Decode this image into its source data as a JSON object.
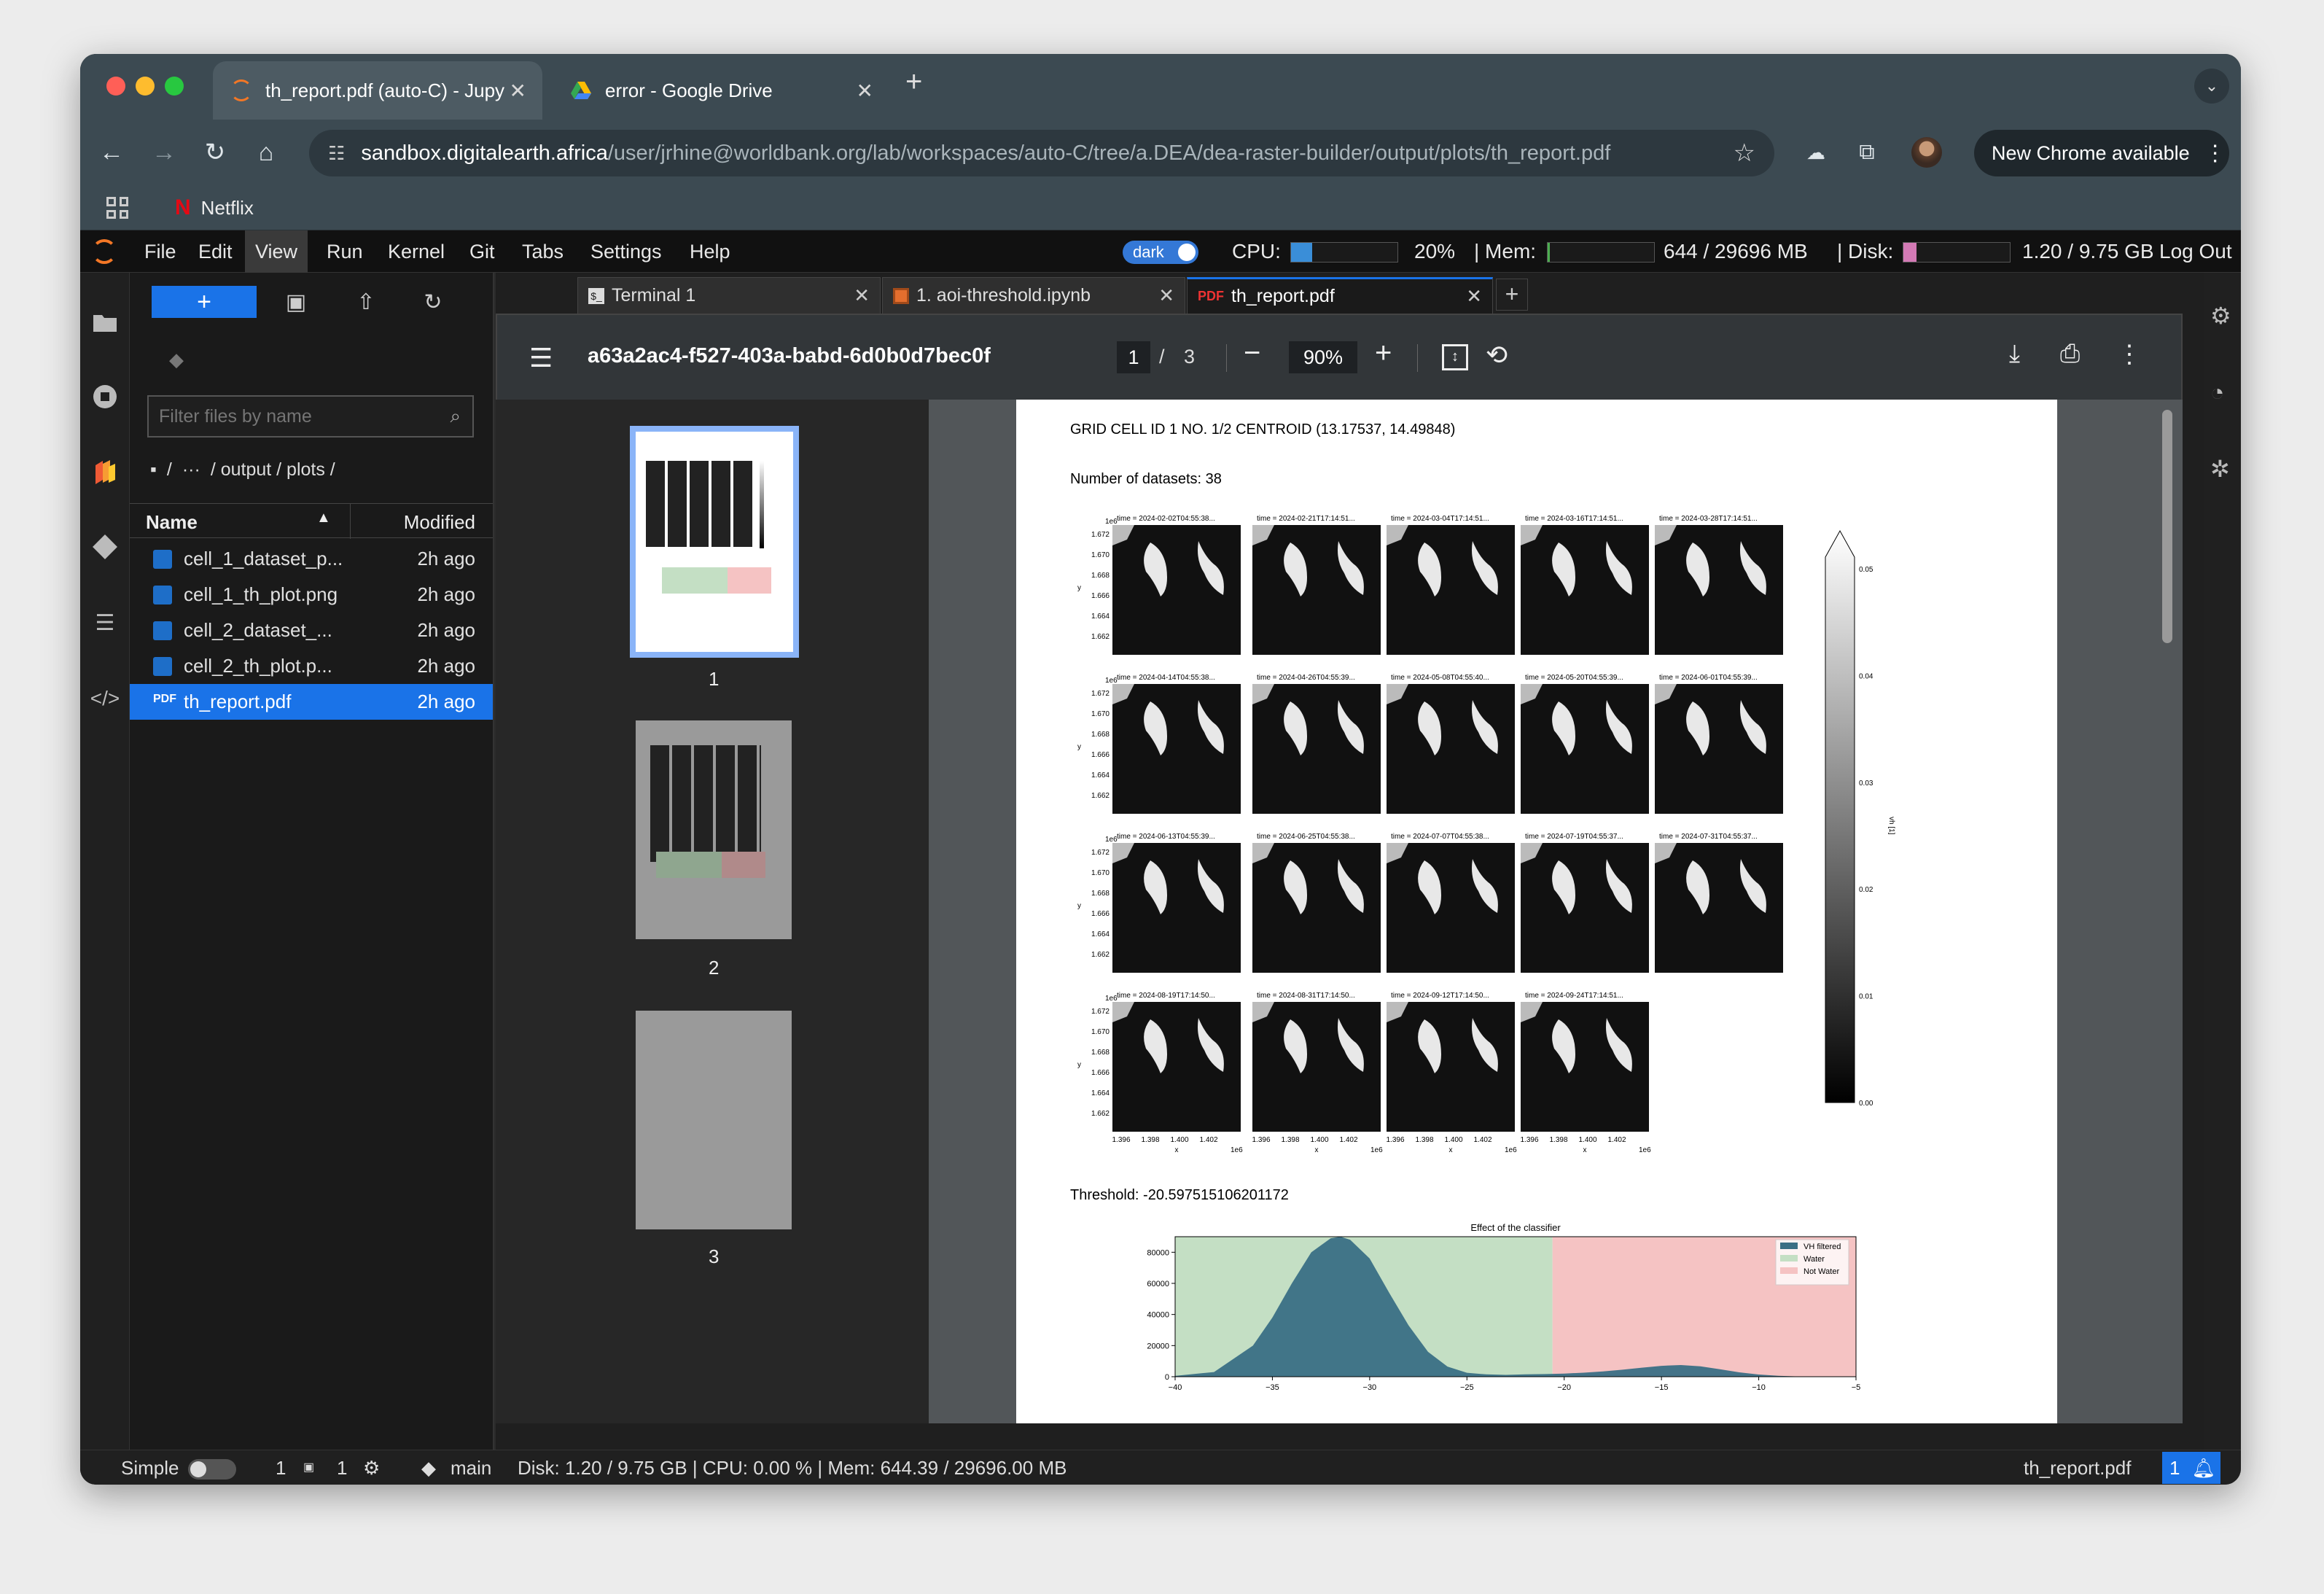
{
  "browser": {
    "tabs": [
      {
        "title": "th_report.pdf (auto-C) - Jupy"
      },
      {
        "title": "error - Google Drive"
      }
    ],
    "new_tab": "+",
    "url_host": "sandbox.digitalearth.africa",
    "url_path": "/user/jrhine@worldbank.org/lab/workspaces/auto-C/tree/a.DEA/dea-raster-builder/output/plots/th_report.pdf",
    "update_label": "New Chrome available",
    "bookmarks": [
      {
        "label": "Netflix"
      }
    ]
  },
  "menu": [
    "File",
    "Edit",
    "View",
    "Run",
    "Kernel",
    "Git",
    "Tabs",
    "Settings",
    "Help"
  ],
  "resources": {
    "theme": "dark",
    "cpu_label": "CPU:",
    "cpu_value": "20%",
    "cpu_fraction": 0.2,
    "mem_label": "| Mem:",
    "mem_value": "644 / 29696 MB",
    "mem_fraction": 0.022,
    "disk_label": "| Disk:",
    "disk_value": "1.20 / 9.75 GB",
    "disk_fraction": 0.123,
    "logout": "Log Out"
  },
  "filebrowser": {
    "new_label": "+",
    "filter_placeholder": "Filter files by name",
    "crumbs": [
      "/",
      "···",
      "/ output / plots /"
    ],
    "col_name": "Name",
    "col_modified": "Modified",
    "files": [
      {
        "name": "cell_1_dataset_p...",
        "modified": "2h ago"
      },
      {
        "name": "cell_1_th_plot.png",
        "modified": "2h ago"
      },
      {
        "name": "cell_2_dataset_...",
        "modified": "2h ago"
      },
      {
        "name": "cell_2_th_plot.p...",
        "modified": "2h ago"
      },
      {
        "name": "th_report.pdf",
        "modified": "2h ago"
      }
    ]
  },
  "doc_tabs": [
    {
      "label": "Terminal 1"
    },
    {
      "label": "1. aoi-threshold.ipynb"
    },
    {
      "label": "th_report.pdf"
    }
  ],
  "pdf": {
    "title": "a63a2ac4-f527-403a-babd-6d0b0d7bec0f",
    "page": "1",
    "page_sep": "/",
    "pages": "3",
    "zoom": "90%",
    "thumb_labels": [
      "1",
      "2",
      "3"
    ],
    "heading": "GRID CELL ID 1 NO. 1/2 CENTROID (13.17537, 14.49848)",
    "datasets": "Number of datasets: 38",
    "grid_titles": [
      "time = 2024-02-02T04:55:38...",
      "time = 2024-02-21T17:14:51...",
      "time = 2024-03-04T17:14:51...",
      "time = 2024-03-16T17:14:51...",
      "time = 2024-03-28T17:14:51...",
      "time = 2024-04-14T04:55:38...",
      "time = 2024-04-26T04:55:39...",
      "time = 2024-05-08T04:55:40...",
      "time = 2024-05-20T04:55:39...",
      "time = 2024-06-01T04:55:39...",
      "time = 2024-06-13T04:55:39...",
      "time = 2024-06-25T04:55:38...",
      "time = 2024-07-07T04:55:38...",
      "time = 2024-07-19T04:55:37...",
      "time = 2024-07-31T04:55:37...",
      "time = 2024-08-19T17:14:50...",
      "time = 2024-08-31T17:14:50...",
      "time = 2024-09-12T17:14:50...",
      "time = 2024-09-24T17:14:51..."
    ],
    "y_ticks": [
      "1.672",
      "1.670",
      "1.668",
      "1.666",
      "1.664",
      "1.662"
    ],
    "x_ticks": [
      "1.396",
      "1.398",
      "1.400",
      "1.402"
    ],
    "axis_exp": "1e6",
    "y_label": "y",
    "x_label": "x",
    "colorbar_ticks": [
      "0.05",
      "0.04",
      "0.03",
      "0.02",
      "0.01",
      "0.00"
    ],
    "colorbar_label": "vh [1]",
    "threshold": "Threshold: -20.597515106201172"
  },
  "chart_data": {
    "type": "area",
    "title": "Effect of the classifier",
    "xlim": [
      -40,
      -5
    ],
    "ylim": [
      0,
      90000
    ],
    "x_ticks": [
      -40,
      -35,
      -30,
      -25,
      -20,
      -15,
      -10,
      -5
    ],
    "y_ticks": [
      0,
      20000,
      40000,
      60000,
      80000
    ],
    "threshold": -20.6,
    "series": [
      {
        "name": "VH filtered",
        "color": "#3a6f85",
        "x": [
          -40,
          -38,
          -36,
          -35,
          -34,
          -33,
          -32,
          -31.5,
          -31,
          -30,
          -29,
          -28,
          -27,
          -26,
          -25,
          -24,
          -23,
          -22,
          -21,
          -20,
          -19,
          -18,
          -17,
          -16,
          -15,
          -14,
          -13,
          -12,
          -11,
          -10,
          -9,
          -8,
          -7,
          -6,
          -5
        ],
        "y": [
          500,
          3000,
          20000,
          38000,
          60000,
          80000,
          89000,
          90000,
          88000,
          76000,
          54000,
          33000,
          16000,
          6500,
          2500,
          1500,
          1200,
          1500,
          1700,
          2000,
          2600,
          3400,
          4500,
          5800,
          7000,
          7500,
          6700,
          4800,
          2800,
          1400,
          600,
          200,
          100,
          0,
          0
        ]
      },
      {
        "name": "Water",
        "color": "#c4dfc4"
      },
      {
        "name": "Not Water",
        "color": "#f5c3c3"
      }
    ]
  },
  "statusbar": {
    "mode": "Simple",
    "terminals": "1",
    "kernels": "1",
    "branch": "main",
    "metrics": "Disk: 1.20 / 9.75 GB | CPU: 0.00 % | Mem: 644.39 / 29696.00 MB",
    "file": "th_report.pdf",
    "notif": "1"
  }
}
